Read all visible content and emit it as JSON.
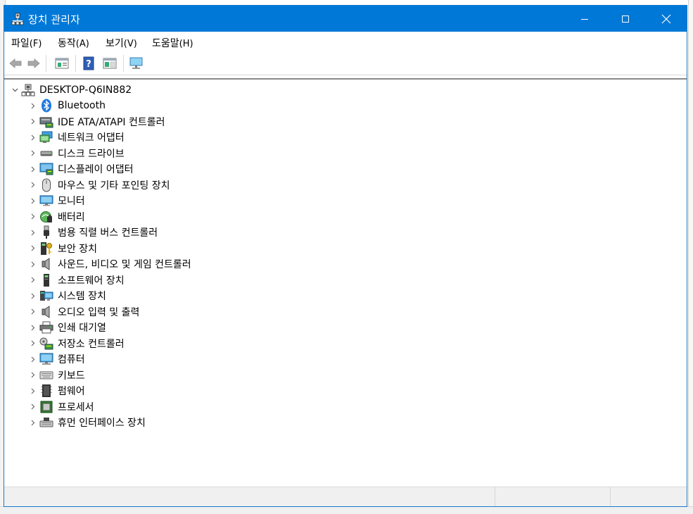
{
  "window": {
    "title": "장치 관리자",
    "controls": {
      "minimize": "minimize",
      "maximize": "maximize",
      "close": "close"
    }
  },
  "menu": [
    {
      "label": "파일",
      "mnemonic": "(F)"
    },
    {
      "label": "동작",
      "mnemonic": "(A)"
    },
    {
      "label": "보기",
      "mnemonic": "(V)"
    },
    {
      "label": "도움말",
      "mnemonic": "(H)"
    }
  ],
  "toolbar": [
    {
      "icon": "back-arrow-icon"
    },
    {
      "icon": "forward-arrow-icon"
    },
    {
      "icon": "properties-icon"
    },
    {
      "icon": "help-icon"
    },
    {
      "icon": "action-pane-icon"
    },
    {
      "icon": "scan-hardware-icon"
    }
  ],
  "tree": {
    "root": {
      "label": "DESKTOP-Q6IN882",
      "icon": "computer-network-icon",
      "expanded": true
    },
    "items": [
      {
        "label": "Bluetooth",
        "icon": "bluetooth-icon"
      },
      {
        "label": "IDE ATA/ATAPI 컨트롤러",
        "icon": "ide-controller-icon"
      },
      {
        "label": "네트워크 어댑터",
        "icon": "network-adapter-icon"
      },
      {
        "label": "디스크 드라이브",
        "icon": "disk-drive-icon"
      },
      {
        "label": "디스플레이 어댑터",
        "icon": "display-adapter-icon"
      },
      {
        "label": "마우스 및 기타 포인팅 장치",
        "icon": "mouse-icon"
      },
      {
        "label": "모니터",
        "icon": "monitor-icon"
      },
      {
        "label": "배터리",
        "icon": "battery-icon"
      },
      {
        "label": "범용 직렬 버스 컨트롤러",
        "icon": "usb-icon"
      },
      {
        "label": "보안 장치",
        "icon": "security-device-icon"
      },
      {
        "label": "사운드, 비디오 및 게임 컨트롤러",
        "icon": "sound-icon"
      },
      {
        "label": "소프트웨어 장치",
        "icon": "software-device-icon"
      },
      {
        "label": "시스템 장치",
        "icon": "system-device-icon"
      },
      {
        "label": "오디오 입력 및 출력",
        "icon": "audio-io-icon"
      },
      {
        "label": "인쇄 대기열",
        "icon": "printer-icon"
      },
      {
        "label": "저장소 컨트롤러",
        "icon": "storage-controller-icon"
      },
      {
        "label": "컴퓨터",
        "icon": "computer-icon"
      },
      {
        "label": "키보드",
        "icon": "keyboard-icon"
      },
      {
        "label": "펌웨어",
        "icon": "firmware-icon"
      },
      {
        "label": "프로세서",
        "icon": "processor-icon"
      },
      {
        "label": "휴먼 인터페이스 장치",
        "icon": "hid-icon"
      }
    ]
  },
  "colors": {
    "titlebar": "#0078d7",
    "accent": "#1979ca"
  }
}
